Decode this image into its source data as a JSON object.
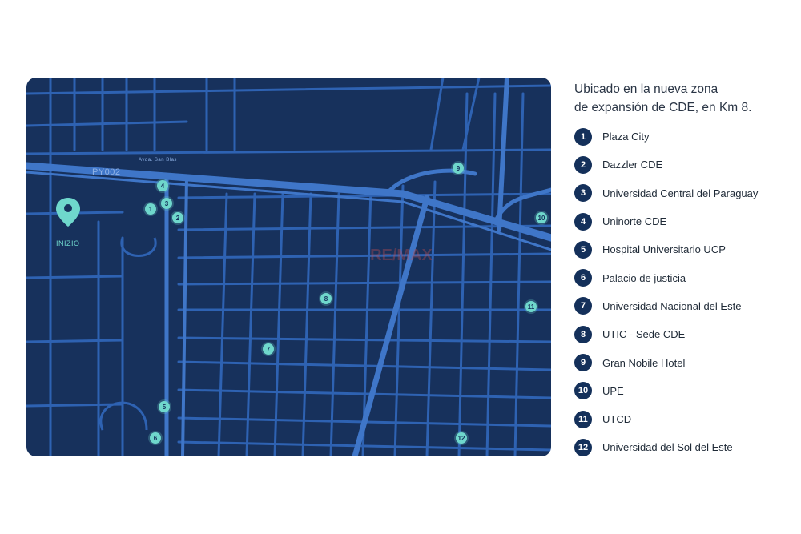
{
  "map": {
    "road_label": "PY002",
    "avenue_label": "Avda. San Blas",
    "start_label": "INIZIO",
    "watermark": "RE/MAX",
    "markers": [
      "1",
      "2",
      "3",
      "4",
      "5",
      "6",
      "7",
      "8",
      "9",
      "10",
      "11",
      "12"
    ]
  },
  "info": {
    "heading_line1": "Ubicado en la nueva zona",
    "heading_line2": "de expansión de CDE, en Km 8."
  },
  "legend": [
    {
      "num": "1",
      "label": "Plaza City"
    },
    {
      "num": "2",
      "label": "Dazzler CDE"
    },
    {
      "num": "3",
      "label": "Universidad Central del Paraguay"
    },
    {
      "num": "4",
      "label": "Uninorte CDE"
    },
    {
      "num": "5",
      "label": "Hospital Universitario UCP"
    },
    {
      "num": "6",
      "label": "Palacio de justicia"
    },
    {
      "num": "7",
      "label": "Universidad Nacional del Este"
    },
    {
      "num": "8",
      "label": "UTIC - Sede CDE"
    },
    {
      "num": "9",
      "label": "Gran Nobile Hotel"
    },
    {
      "num": "10",
      "label": "UPE"
    },
    {
      "num": "11",
      "label": "UTCD"
    },
    {
      "num": "12",
      "label": "Universidad del Sol del Este"
    }
  ]
}
